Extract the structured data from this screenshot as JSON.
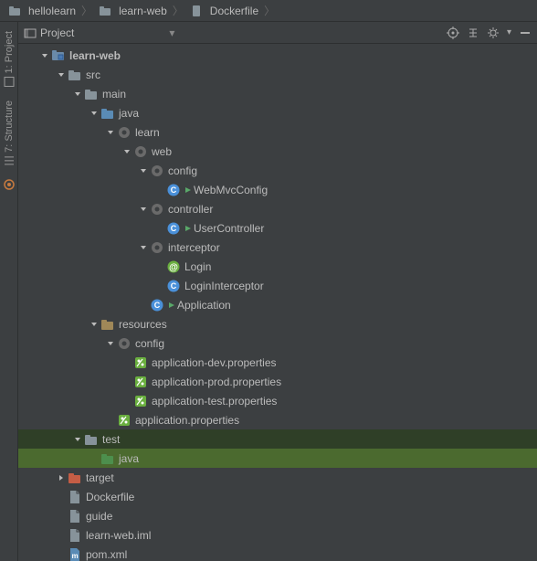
{
  "breadcrumb": [
    {
      "label": "hellolearn",
      "icon": "folder"
    },
    {
      "label": "learn-web",
      "icon": "folder"
    },
    {
      "label": "Dockerfile",
      "icon": "file"
    }
  ],
  "sidebar": {
    "project_tab": "1: Project",
    "structure_tab": "7: Structure"
  },
  "toolbar": {
    "project_label": "Project",
    "dropdown": "▾"
  },
  "tree": [
    {
      "d": 0,
      "exp": true,
      "icon": "module",
      "label": "learn-web",
      "bold": true
    },
    {
      "d": 1,
      "exp": true,
      "icon": "folder",
      "label": "src"
    },
    {
      "d": 2,
      "exp": true,
      "icon": "folder",
      "label": "main"
    },
    {
      "d": 3,
      "exp": true,
      "icon": "folder-src",
      "label": "java"
    },
    {
      "d": 4,
      "exp": true,
      "icon": "package",
      "label": "learn"
    },
    {
      "d": 5,
      "exp": true,
      "icon": "package",
      "label": "web"
    },
    {
      "d": 6,
      "exp": true,
      "icon": "package",
      "label": "config"
    },
    {
      "d": 7,
      "icon": "class",
      "run": true,
      "label": "WebMvcConfig"
    },
    {
      "d": 6,
      "exp": true,
      "icon": "package",
      "label": "controller"
    },
    {
      "d": 7,
      "icon": "class",
      "run": true,
      "label": "UserController"
    },
    {
      "d": 6,
      "exp": true,
      "icon": "package",
      "label": "interceptor"
    },
    {
      "d": 7,
      "icon": "annotation",
      "label": "Login"
    },
    {
      "d": 7,
      "icon": "class",
      "label": "LoginInterceptor"
    },
    {
      "d": 6,
      "icon": "class",
      "run": true,
      "label": "Application"
    },
    {
      "d": 3,
      "exp": true,
      "icon": "folder-res",
      "label": "resources"
    },
    {
      "d": 4,
      "exp": true,
      "icon": "package",
      "label": "config"
    },
    {
      "d": 5,
      "icon": "prop",
      "label": "application-dev.properties"
    },
    {
      "d": 5,
      "icon": "prop",
      "label": "application-prod.properties"
    },
    {
      "d": 5,
      "icon": "prop",
      "label": "application-test.properties"
    },
    {
      "d": 4,
      "icon": "prop",
      "label": "application.properties"
    },
    {
      "d": 2,
      "exp": true,
      "icon": "folder",
      "label": "test",
      "sel2": true
    },
    {
      "d": 3,
      "icon": "folder-test",
      "label": "java",
      "sel": true
    },
    {
      "d": 1,
      "exp": false,
      "icon": "folder-excl",
      "label": "target"
    },
    {
      "d": 1,
      "icon": "file",
      "label": "Dockerfile"
    },
    {
      "d": 1,
      "icon": "file",
      "label": "guide"
    },
    {
      "d": 1,
      "icon": "file",
      "label": "learn-web.iml"
    },
    {
      "d": 1,
      "icon": "maven",
      "label": "pom.xml"
    }
  ]
}
